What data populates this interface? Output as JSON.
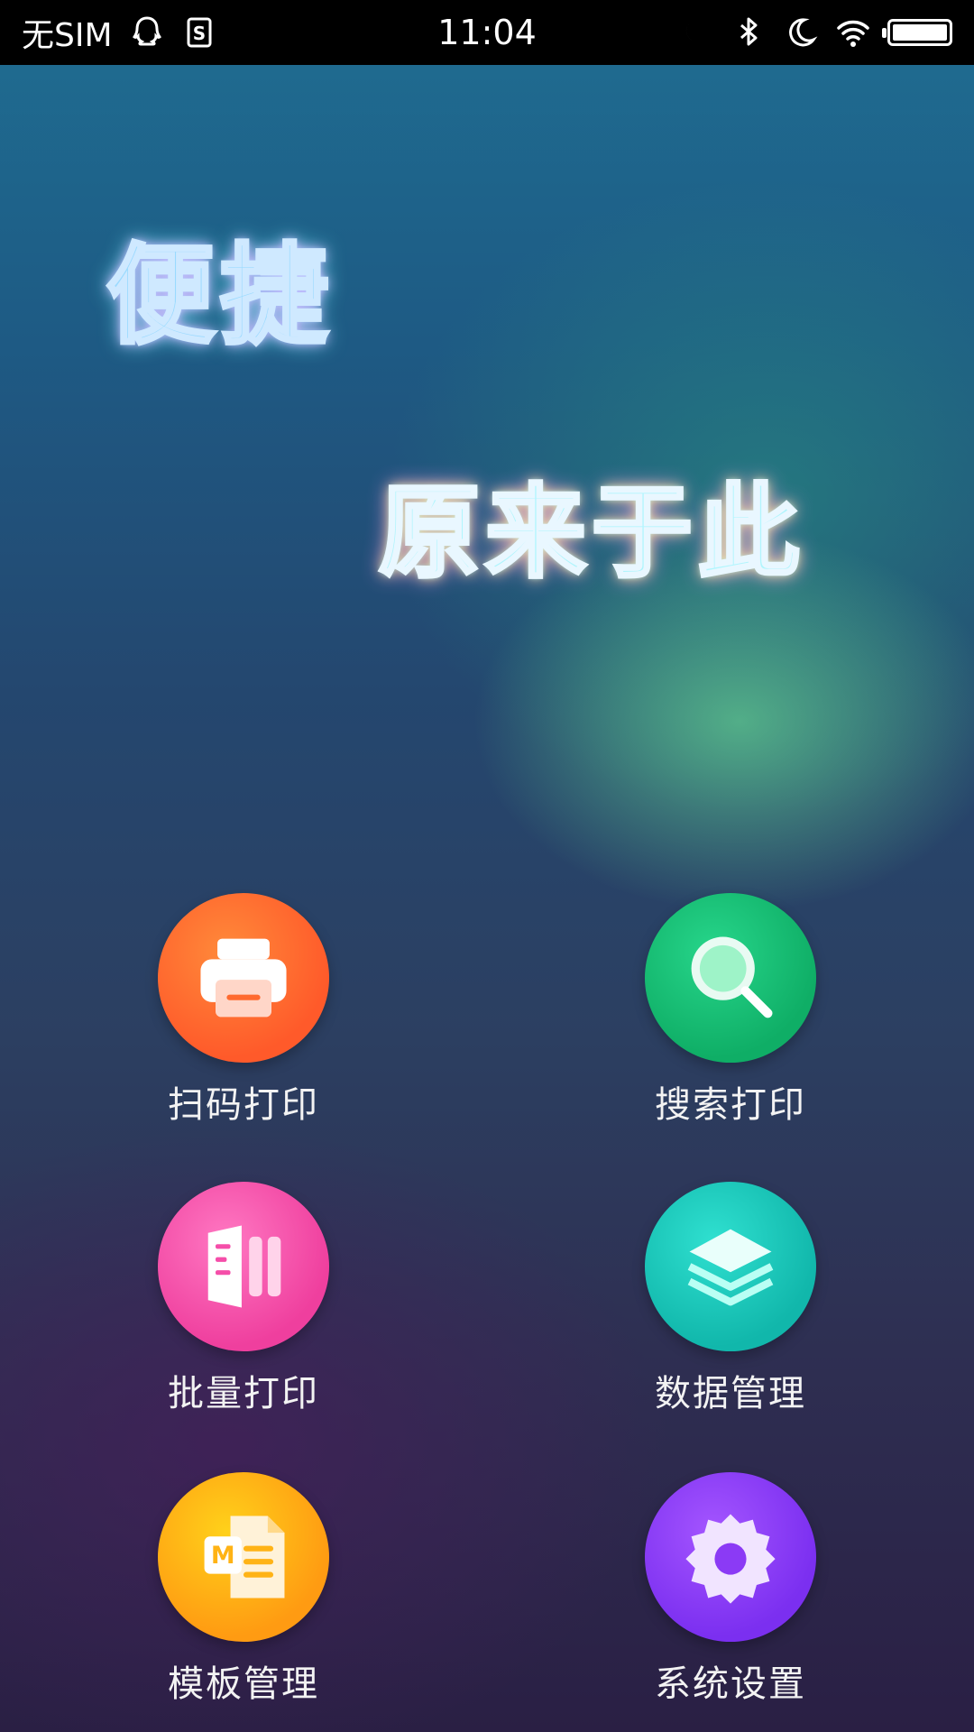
{
  "status_bar": {
    "carrier": "无SIM",
    "time": "11:04",
    "icons": [
      "qq-icon",
      "sim-s-icon",
      "sleep-icon",
      "bluetooth-icon",
      "moon-icon",
      "wifi-icon",
      "battery-icon"
    ]
  },
  "slogan": {
    "line1": "便捷",
    "line2": "原来于此"
  },
  "menu": {
    "items": [
      {
        "label": "扫码打印",
        "icon": "printer-icon",
        "color": "#ff6a2f"
      },
      {
        "label": "搜索打印",
        "icon": "search-icon",
        "color": "#16c072"
      },
      {
        "label": "批量打印",
        "icon": "batch-document-icon",
        "color": "#f54ea9"
      },
      {
        "label": "数据管理",
        "icon": "layers-icon",
        "color": "#1ac8ba"
      },
      {
        "label": "模板管理",
        "icon": "template-document-icon",
        "color": "#ffb315"
      },
      {
        "label": "系统设置",
        "icon": "gear-icon",
        "color": "#8b3af5"
      }
    ]
  }
}
